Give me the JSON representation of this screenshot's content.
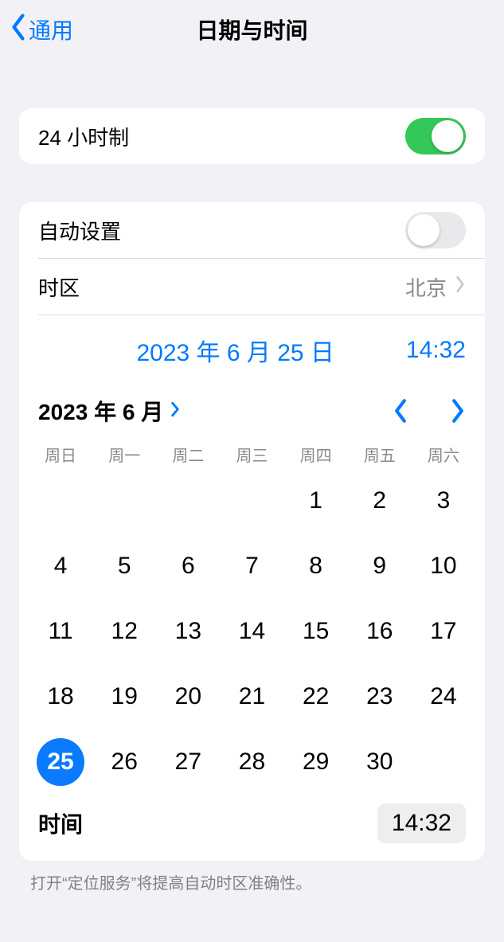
{
  "nav": {
    "back_label": "通用",
    "title": "日期与时间"
  },
  "section1": {
    "hour24_label": "24 小时制",
    "hour24_on": true
  },
  "section2": {
    "autoset_label": "自动设置",
    "autoset_on": false,
    "timezone_label": "时区",
    "timezone_value": "北京",
    "current_date_label": "2023 年 6 月 25 日",
    "current_time_label": "14:32",
    "month_title": "2023 年 6 月",
    "weekdays": [
      "周日",
      "周一",
      "周二",
      "周三",
      "周四",
      "周五",
      "周六"
    ],
    "leading_blanks": 4,
    "days_in_month": 30,
    "selected_day": 25,
    "time_row_label": "时间",
    "time_chip_value": "14:32"
  },
  "footer_note": "打开“定位服务”将提高自动时区准确性。"
}
